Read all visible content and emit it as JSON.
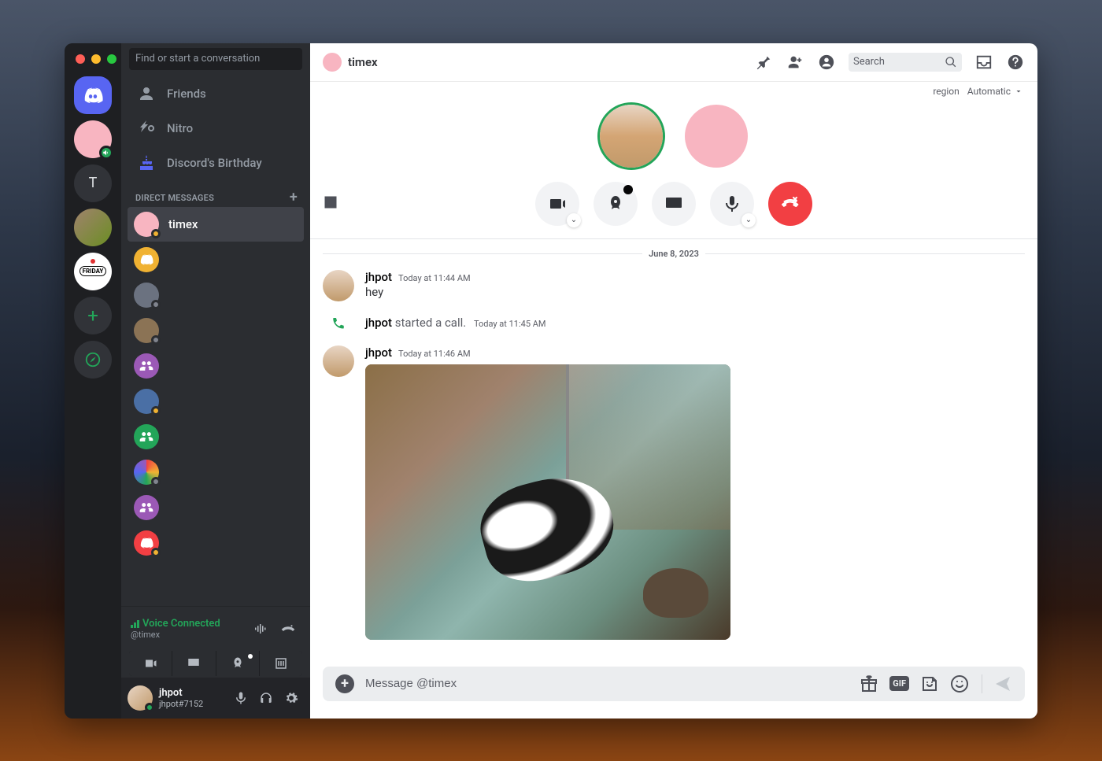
{
  "search_placeholder": "Find or start a conversation",
  "nav": {
    "friends": "Friends",
    "nitro": "Nitro",
    "birthday": "Discord's Birthday"
  },
  "dm_header": "DIRECT MESSAGES",
  "dms": {
    "d0": "timex"
  },
  "voice": {
    "status": "Voice Connected",
    "channel": "@timex"
  },
  "user": {
    "name": "jhpot",
    "tag": "jhpot#7152"
  },
  "header": {
    "title": "timex",
    "search": "Search",
    "region_label": "region",
    "region_value": "Automatic"
  },
  "chat": {
    "date": "June 8, 2023",
    "m1_author": "jhpot",
    "m1_time": "Today at 11:44 AM",
    "m1_text": "hey",
    "sys_author": "jhpot",
    "sys_text": " started a call.",
    "sys_time": "Today at 11:45 AM",
    "m2_author": "jhpot",
    "m2_time": "Today at 11:46 AM"
  },
  "composer": {
    "placeholder": "Message @timex"
  },
  "servers": {
    "s2_initial": "T",
    "friday": "FRIDAY"
  }
}
